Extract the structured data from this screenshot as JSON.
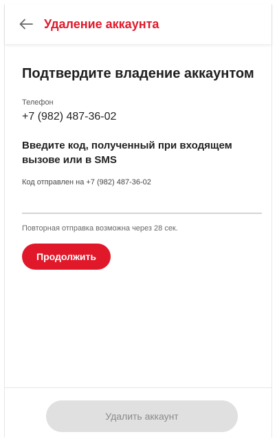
{
  "header": {
    "title": "Удаление аккаунта",
    "back_icon": "arrow-left-icon"
  },
  "main": {
    "heading": "Подтвердите владение аккаунтом",
    "phone_label": "Телефон",
    "phone_value": "+7 (982) 487-36-02",
    "code_instruction": "Введите код, полученный при входящем вызове или в SMS",
    "code_sent_text": "Код отправлен на +7 (982) 487-36-02",
    "code_input_value": "",
    "resend_note": "Повторная отправка возможна через 28 сек.",
    "continue_label": "Продолжить"
  },
  "footer": {
    "delete_label": "Удалить аккаунт",
    "delete_disabled": true
  },
  "colors": {
    "accent": "#e1182a",
    "disabled_bg": "#e0e0e0",
    "disabled_text": "#8a8a8a"
  }
}
